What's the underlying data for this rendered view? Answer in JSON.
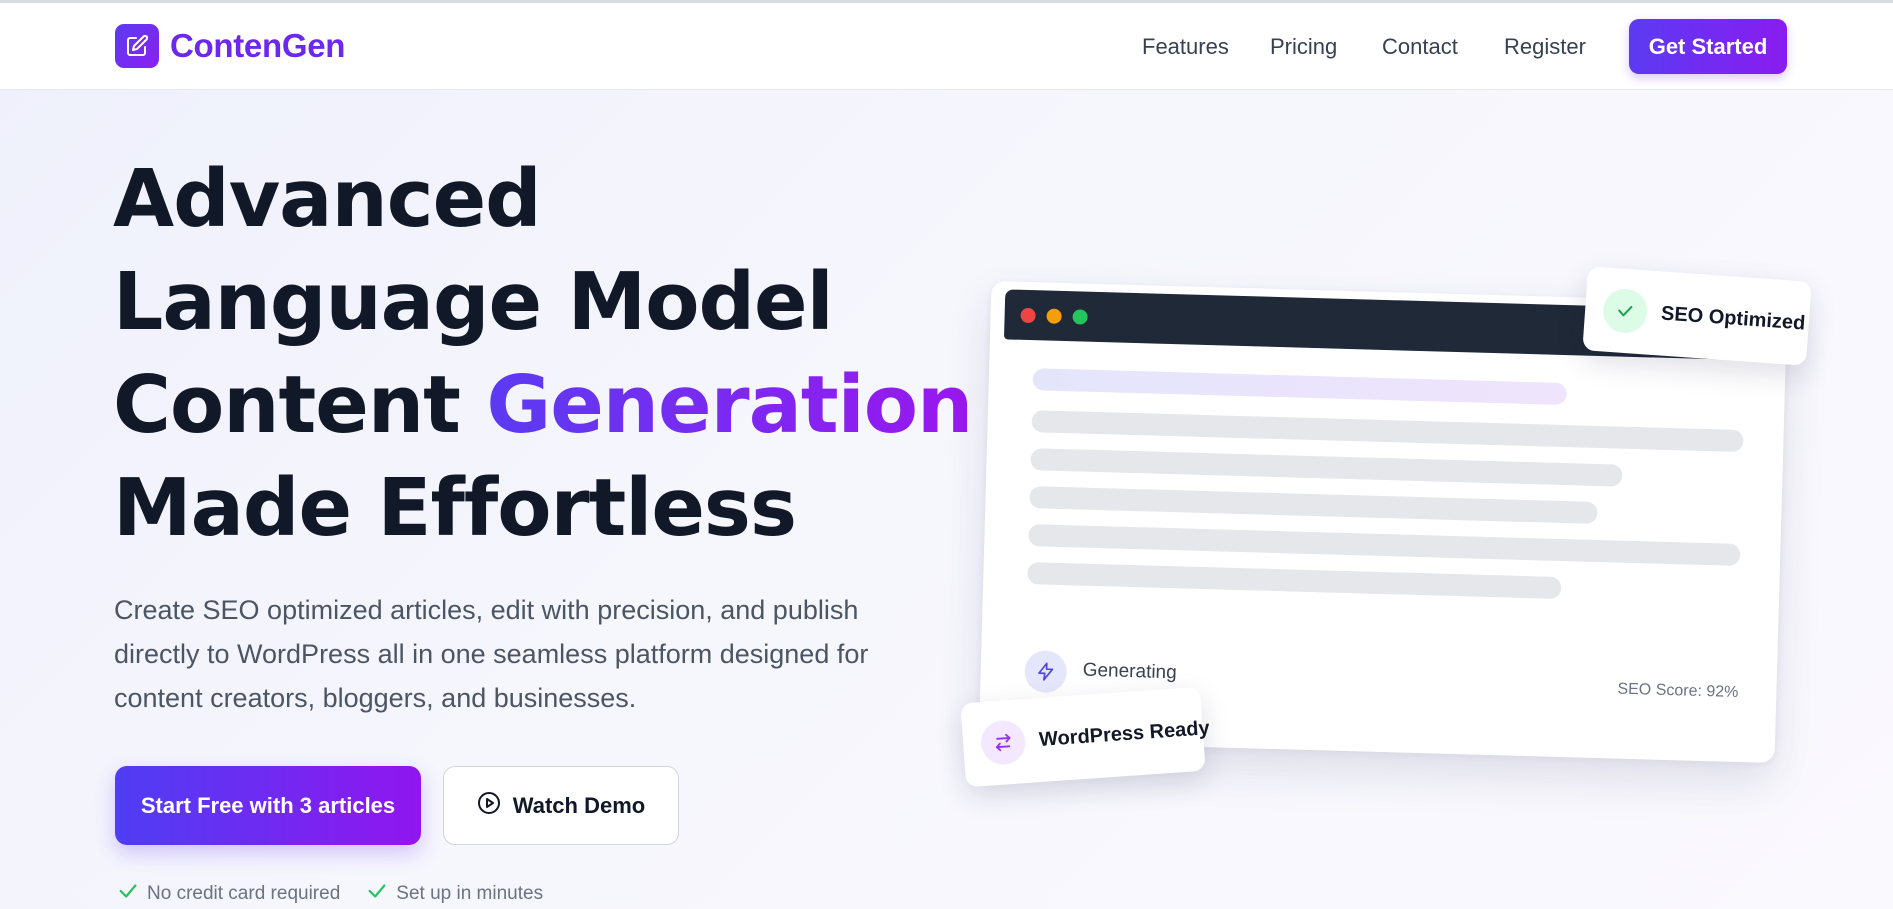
{
  "brand": {
    "name": "ContenGen",
    "accent": "#6d28f0",
    "gradient_start": "#5b3bf2",
    "gradient_end": "#9016ef"
  },
  "nav": {
    "items": [
      {
        "label": "Features"
      },
      {
        "label": "Pricing"
      },
      {
        "label": "Contact"
      },
      {
        "label": "Register"
      }
    ],
    "cta_label": "Get Started"
  },
  "hero": {
    "title_lines": [
      "Advanced",
      "Language Model"
    ],
    "title_line3_prefix": "Content ",
    "title_highlight": "Generation",
    "title_line4": "Made Effortless",
    "subtitle": "Create SEO optimized articles, edit with precision, and publish directly to WordPress all in one seamless platform designed for content creators, bloggers, and businesses.",
    "primary_cta": "Start Free with 3 articles",
    "secondary_cta": "Watch Demo",
    "perks": [
      "No credit card required",
      "Set up in minutes"
    ]
  },
  "preview": {
    "status_text": "Generating",
    "seo_score": "SEO Score: 92%",
    "badge_seo": "SEO Optimized",
    "badge_wordpress": "WordPress Ready",
    "window_dots": [
      "#ef4444",
      "#f59e0b",
      "#22c55e"
    ],
    "icons": {
      "status": "lightning-icon",
      "seo_badge": "check-icon",
      "wordpress_badge": "sync-arrows-icon"
    }
  }
}
